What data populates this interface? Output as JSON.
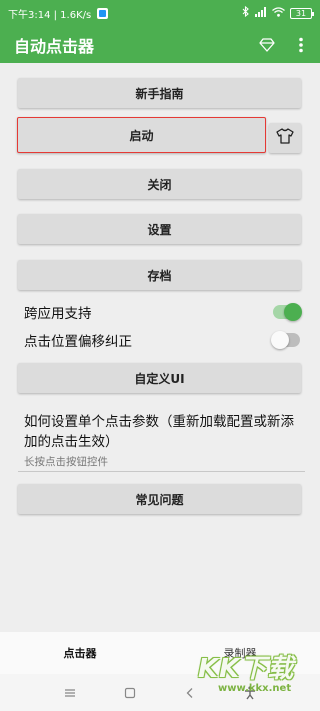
{
  "status_bar": {
    "time_speed": "下午3:14 | 1.6K/s",
    "bluetooth_icon": "bluetooth-icon",
    "signal_icon": "signal-icon",
    "wifi_icon": "wifi-icon",
    "battery": "31"
  },
  "app_bar": {
    "title": "自动点击器",
    "diamond_icon": "diamond-icon",
    "more_icon": "more-vertical-icon"
  },
  "buttons": {
    "guide": "新手指南",
    "start": "启动",
    "close": "关闭",
    "settings": "设置",
    "archive": "存档",
    "custom_ui": "自定义UI",
    "faq": "常见问题"
  },
  "settings": {
    "cross_app": {
      "label": "跨应用支持",
      "enabled": true
    },
    "offset_correction": {
      "label": "点击位置偏移纠正",
      "enabled": false
    }
  },
  "help": {
    "title": "如何设置单个点击参数（重新加载配置或新添加的点击生效）",
    "subtitle": "长按点击按钮控件"
  },
  "bottom_tabs": {
    "clicker": "点击器",
    "recorder": "录制器"
  },
  "watermark": {
    "big": "KK下载",
    "small": "www.kkx.net"
  },
  "colors": {
    "primary": "#4caf50",
    "highlight_border": "#e53935",
    "button_bg": "#dcdcdc",
    "background": "#eeeeee"
  }
}
